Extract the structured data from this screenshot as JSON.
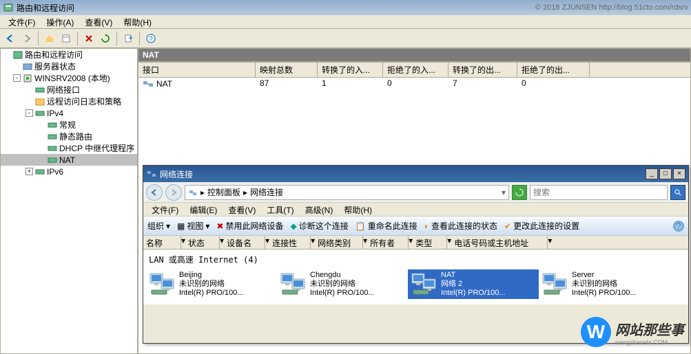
{
  "titlebar": {
    "title": "路由和远程访问",
    "copyright": "© 2018 ZJUNSEN http://blog.51cto.com/rdsrv"
  },
  "menu": {
    "file": "文件(F)",
    "action": "操作(A)",
    "view": "查看(V)",
    "help": "帮助(H)"
  },
  "tree": {
    "root": "路由和远程访问",
    "status": "服务器状态",
    "server": "WINSRV2008 (本地)",
    "net_if": "网络接口",
    "remote_log": "远程访问日志和策略",
    "ipv4": "IPv4",
    "general": "常规",
    "static_route": "静态路由",
    "dhcp_relay": "DHCP 中继代理程序",
    "nat": "NAT",
    "ipv6": "IPv6"
  },
  "right": {
    "header": "NAT",
    "cols": {
      "iface": "接口",
      "map_total": "映射总数",
      "trans_in": "转换了的入...",
      "rej_in": "拒绝了的入...",
      "trans_out": "转换了的出...",
      "rej_out": "拒绝了的出..."
    },
    "row": {
      "name": "NAT",
      "map": "87",
      "tin": "1",
      "rin": "0",
      "tout": "7",
      "rout": "0"
    }
  },
  "nc": {
    "title": "网络连接",
    "crumb1": "控制面板",
    "crumb2": "网络连接",
    "search_ph": "搜索",
    "menu": {
      "file": "文件(F)",
      "edit": "编辑(E)",
      "view": "查看(V)",
      "tools": "工具(T)",
      "adv": "高级(N)",
      "help": "帮助(H)"
    },
    "cmd": {
      "org": "组织",
      "view": "视图",
      "disable": "禁用此网络设备",
      "diag": "诊断这个连接",
      "rename": "重命名此连接",
      "status": "查看此连接的状态",
      "change": "更改此连接的设置"
    },
    "cols": {
      "name": "名称",
      "status": "状态",
      "dev": "设备名",
      "conn": "连接性",
      "net": "网络类别",
      "owner": "所有者",
      "type": "类型",
      "phone": "电话号码或主机地址"
    },
    "group": "LAN 或高速 Internet (4)",
    "items": [
      {
        "name": "Beijing",
        "net": "未识别的网络",
        "dev": "Intel(R) PRO/100...",
        "sel": false
      },
      {
        "name": "Chengdu",
        "net": "未识别的网络",
        "dev": "Intel(R) PRO/100...",
        "sel": false
      },
      {
        "name": "NAT",
        "net": "网络  2",
        "dev": "Intel(R) PRO/100...",
        "sel": true
      },
      {
        "name": "Server",
        "net": "未识别的网络",
        "dev": "Intel(R) PRO/100...",
        "sel": false
      }
    ]
  },
  "watermark": {
    "glyph": "W",
    "text": "网站那些事",
    "sub": "wangzhanshi.COM"
  }
}
